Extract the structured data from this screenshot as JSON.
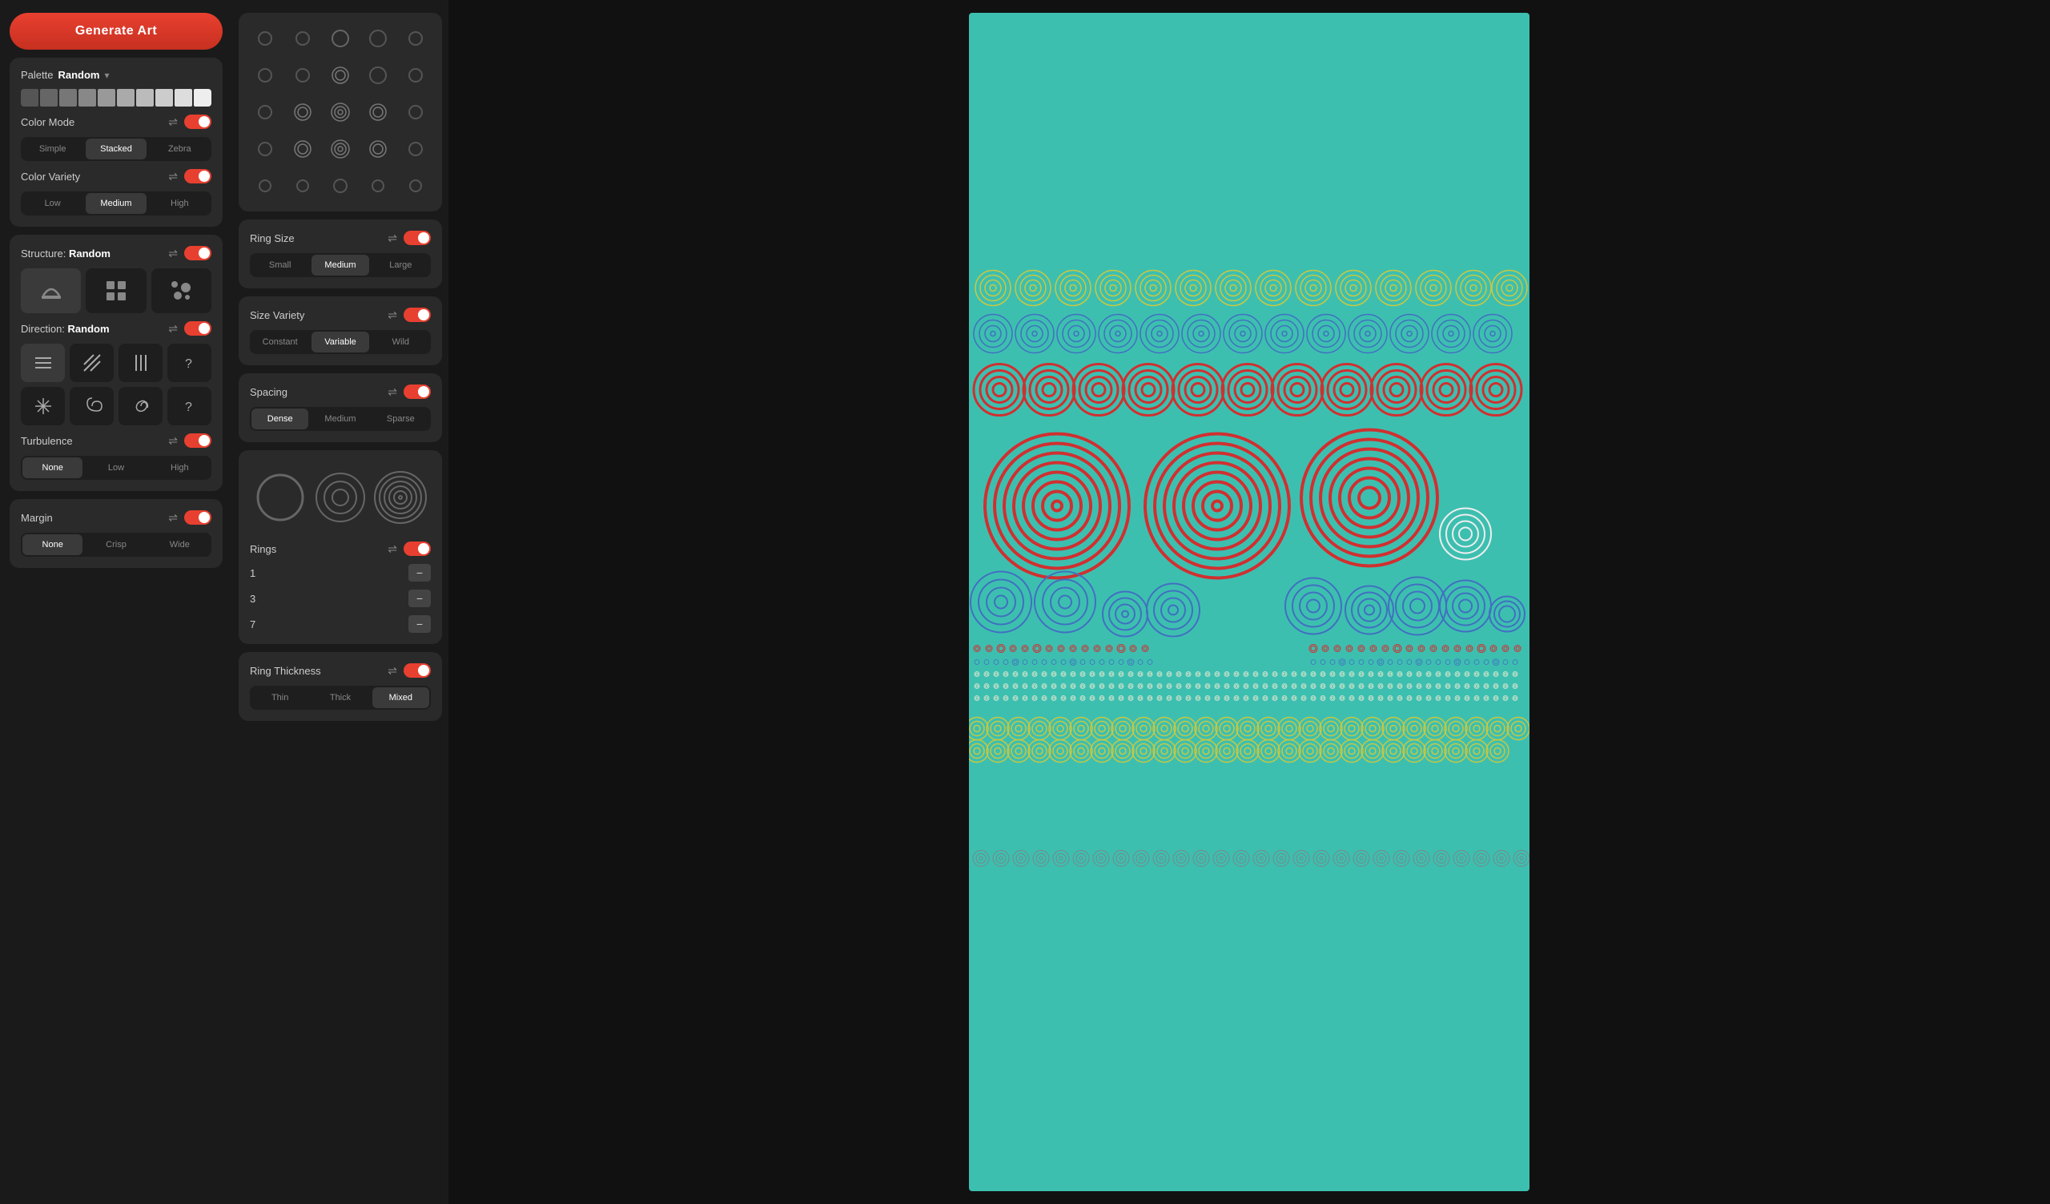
{
  "generate_btn": "Generate Art",
  "palette": {
    "label": "Palette",
    "value": "Random",
    "swatches": [
      "#555",
      "#666",
      "#777",
      "#888",
      "#999",
      "#aaa",
      "#bbb",
      "#ccc",
      "#ddd",
      "#eee"
    ]
  },
  "color_mode": {
    "label": "Color Mode",
    "options": [
      "Simple",
      "Stacked",
      "Zebra"
    ],
    "active": "Stacked"
  },
  "color_variety": {
    "label": "Color Variety",
    "options": [
      "Low",
      "Medium",
      "High"
    ],
    "active": "Medium"
  },
  "structure": {
    "label": "Structure:",
    "value": "Random",
    "options": [
      "arch",
      "grid",
      "scatter"
    ]
  },
  "direction": {
    "label": "Direction:",
    "value": "Random"
  },
  "turbulence": {
    "label": "Turbulence",
    "options": [
      "None",
      "Low",
      "High"
    ],
    "active": "None"
  },
  "margin": {
    "label": "Margin",
    "options": [
      "None",
      "Crisp",
      "Wide"
    ],
    "active": "None"
  },
  "ring_size": {
    "label": "Ring Size",
    "options": [
      "Small",
      "Medium",
      "Large"
    ],
    "active": "Medium"
  },
  "size_variety": {
    "label": "Size Variety",
    "options": [
      "Constant",
      "Variable",
      "Wild"
    ],
    "active": "Variable"
  },
  "spacing": {
    "label": "Spacing",
    "options": [
      "Dense",
      "Medium",
      "Sparse"
    ],
    "active": "Dense"
  },
  "rings": {
    "label": "Rings",
    "values": [
      1,
      3,
      7
    ]
  },
  "ring_thickness": {
    "label": "Ring Thickness",
    "options": [
      "Thin",
      "Thick",
      "Mixed"
    ],
    "active": "Mixed"
  },
  "icons": {
    "shuffle": "⇌",
    "minus": "−",
    "chevron_down": "▾"
  },
  "canvas": {
    "background": "#3dbfb0"
  }
}
